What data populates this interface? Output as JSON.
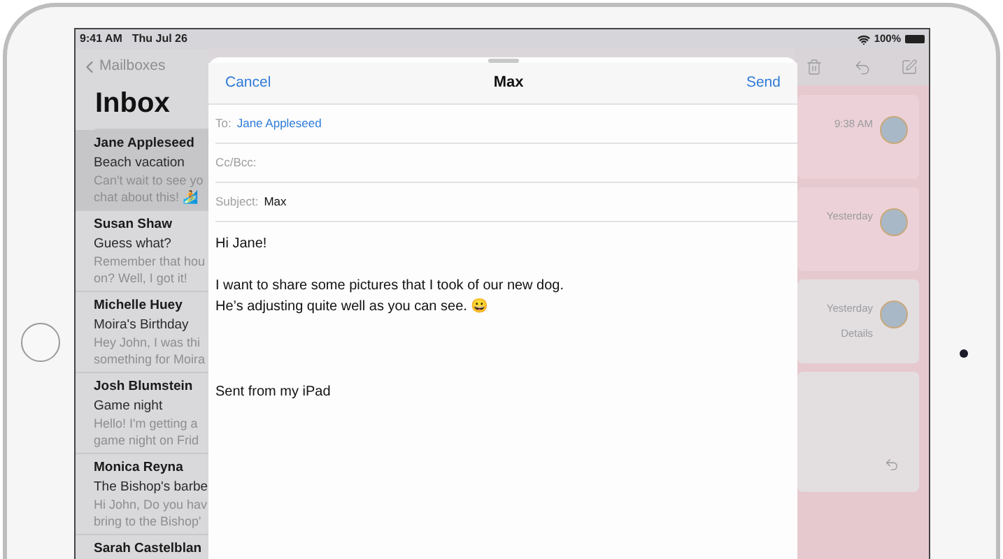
{
  "status_bar": {
    "time": "9:41 AM",
    "date": "Thu Jul 26",
    "battery": "100%"
  },
  "sidebar": {
    "back": "Mailboxes",
    "title": "Inbox",
    "items": [
      {
        "sender": "Jane Appleseed",
        "subject": "Beach vacation",
        "preview": [
          "Can't wait to see yo",
          "chat about this! 🏄"
        ],
        "selected": true
      },
      {
        "sender": "Susan Shaw",
        "subject": "Guess what?",
        "preview": [
          "Remember that hou",
          "on? Well, I got it!"
        ],
        "selected": false
      },
      {
        "sender": "Michelle Huey",
        "subject": "Moira's Birthday",
        "preview": [
          "Hey John, I was thi",
          "something for Moira"
        ],
        "selected": false
      },
      {
        "sender": "Josh Blumstein",
        "subject": "Game night",
        "preview": [
          "Hello! I'm getting a",
          "game night on Frid"
        ],
        "selected": false
      },
      {
        "sender": "Monica Reyna",
        "subject": "The Bishop's barbe",
        "preview": [
          "Hi John, Do you hav",
          "bring to the Bishop'"
        ],
        "selected": false
      },
      {
        "sender": "Sarah Castelblan",
        "selected": false
      }
    ]
  },
  "compose": {
    "cancel": "Cancel",
    "title": "Max",
    "send": "Send",
    "fields": [
      {
        "label": "To:",
        "value": "Jane Appleseed",
        "kind": "recipient"
      },
      {
        "label": "Cc/Bcc:",
        "kind": "plain"
      },
      {
        "label": "Subject:",
        "value": "Max",
        "kind": "plain"
      }
    ],
    "body": [
      {
        "kind": "text",
        "lines": [
          "Hi Jane!"
        ]
      },
      {
        "kind": "text",
        "lines": [
          "I want to share some pictures that I took of our new dog.",
          "He’s adjusting quite well as you can see. 😀"
        ]
      },
      {
        "kind": "signature",
        "lines": [
          "Sent from my iPad"
        ]
      }
    ]
  },
  "messages": [
    {
      "kind": "message",
      "time": "9:38 AM"
    },
    {
      "kind": "message",
      "time": "Yesterday"
    },
    {
      "kind": "message",
      "time": "Yesterday",
      "link": "Details"
    },
    {
      "kind": "reply"
    }
  ]
}
